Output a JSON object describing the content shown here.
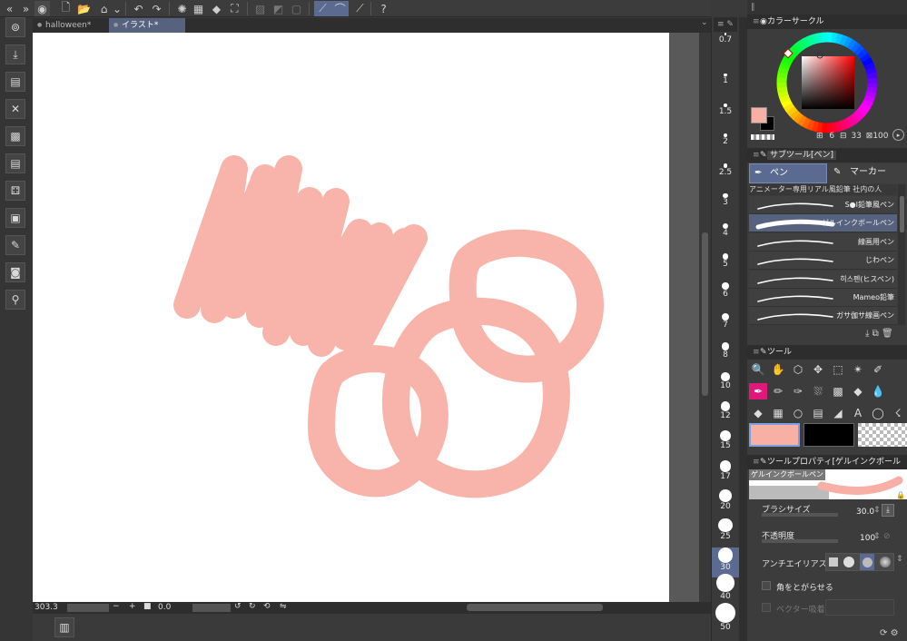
{
  "tabs": [
    "halloween*",
    "イラスト*"
  ],
  "status": {
    "zoom": "303.3",
    "angle": "0.0"
  },
  "brush_sizes": [
    "0.7",
    "1",
    "1.5",
    "2",
    "2.5",
    "3",
    "4",
    "5",
    "6",
    "7",
    "8",
    "10",
    "12",
    "15",
    "17",
    "20",
    "25",
    "30",
    "40",
    "50"
  ],
  "selected_brush_size": "30",
  "color_panel": {
    "title": "カラーサークル",
    "main_color": "#f9b0a4",
    "sub_color": "#000000",
    "h_value": "6",
    "s_value": "33",
    "v_value": "100"
  },
  "subtool_panel": {
    "title": "サブツール[ペン]",
    "tabs": [
      "ペン",
      "マーカー"
    ],
    "group_label": "アニメーター専用リアル風鉛筆 社内の人",
    "items": [
      "S●I鉛筆風ペン",
      "ゲルインクボールペン",
      "線画用ペン",
      "じわペン",
      "히스펜(ヒスペン)",
      "Mameo鉛筆",
      "ガサ伽サ線画ペン"
    ],
    "selected": "ゲルインクボールペン"
  },
  "tool_panel": {
    "title": "ツール"
  },
  "props_panel": {
    "title": "ツールプロパティ[ゲルインクボール",
    "preview_label": "ゲルインクボールペン",
    "brush_size_label": "ブラシサイズ",
    "brush_size_value": "30.0",
    "opacity_label": "不透明度",
    "opacity_value": "100",
    "antialias_label": "アンチエイリアス",
    "sharpen_label": "角をとがらせる",
    "vector_label": "ベクター吸着"
  },
  "colors": {
    "stroke": "#f8b0a6",
    "accent": "#5a6a90",
    "tool_sel": "#e0187a"
  }
}
